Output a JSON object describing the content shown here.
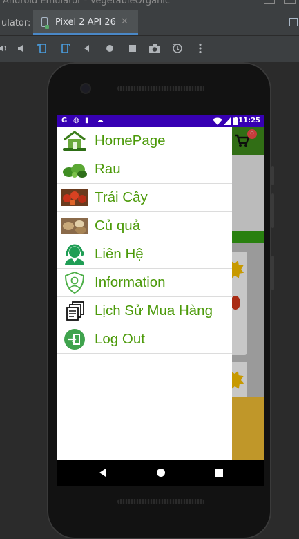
{
  "window": {
    "title": "Android Emulator - VegetableOrganic"
  },
  "tabbar": {
    "prefix_label": "ulator:",
    "device_tab": "Pixel 2 API 26",
    "close_glyph": "✕"
  },
  "toolbar": {
    "buttons": [
      "volume-up",
      "volume-down",
      "rotate-left",
      "rotate-right",
      "back",
      "home",
      "overview",
      "screenshot",
      "zoom",
      "more"
    ]
  },
  "statusbar": {
    "time": "11:25",
    "left_icons": [
      "G",
      "◍",
      "▮",
      "☁"
    ]
  },
  "app": {
    "cart_count": "0"
  },
  "drawer": {
    "items": [
      {
        "label": "HomePage",
        "icon": "home-icon"
      },
      {
        "label": "Rau",
        "icon": "vegetable-icon"
      },
      {
        "label": "Trái Cây",
        "icon": "fruit-icon"
      },
      {
        "label": "Củ quả",
        "icon": "root-vegetable-icon"
      },
      {
        "label": "Liên Hệ",
        "icon": "support-agent-icon"
      },
      {
        "label": "Information",
        "icon": "user-shield-icon"
      },
      {
        "label": "Lịch Sử Mua Hàng",
        "icon": "order-history-icon"
      },
      {
        "label": "Log Out",
        "icon": "logout-icon"
      }
    ]
  },
  "colors": {
    "accent_green": "#4c9a0a",
    "statusbar": "#3700b3",
    "appbar": "#3f8e1c",
    "ide_tab_underline": "#4a88c7"
  }
}
